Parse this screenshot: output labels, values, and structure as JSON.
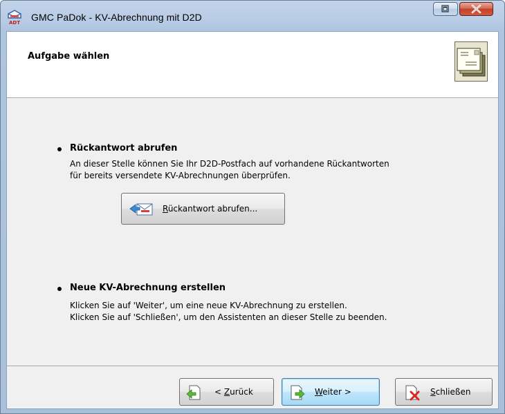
{
  "window": {
    "title": "GMC PaDok  -  KV-Abrechnung mit D2D",
    "app_icon_badge": "ADT"
  },
  "header": {
    "title": "Aufgabe wählen"
  },
  "section_response": {
    "title": "Rückantwort abrufen",
    "line1": "An dieser Stelle können Sie Ihr D2D-Postfach auf vorhandene Rückantworten",
    "line2": "für bereits versendete KV-Abrechnungen überprüfen.",
    "button_accel": "R",
    "button_rest": "ückantwort abrufen..."
  },
  "section_new": {
    "title": "Neue KV-Abrechnung erstellen",
    "line1": "Klicken Sie auf 'Weiter', um eine neue KV-Abrechnung zu erstellen.",
    "line2": "Klicken Sie auf 'Schließen', um den Assistenten an dieser Stelle zu beenden."
  },
  "footer": {
    "back_prefix": "< ",
    "back_accel": "Z",
    "back_rest": "urück",
    "next_accel": "W",
    "next_rest": "eiter >",
    "close_accel": "S",
    "close_rest": "chließen"
  },
  "colors": {
    "titlebar": "#b7cbe4",
    "close_button": "#c2412a",
    "dialog_bg": "#f0f0f0",
    "focus_border": "#3c7fb1"
  }
}
